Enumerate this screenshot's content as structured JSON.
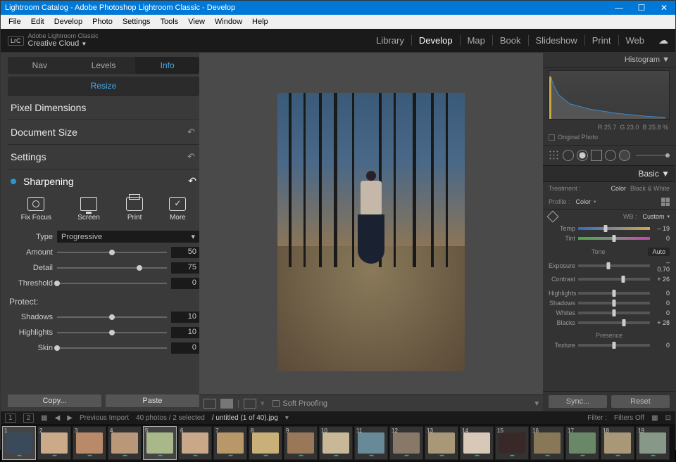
{
  "titlebar": {
    "title": "Lightroom Catalog - Adobe Photoshop Lightroom Classic - Develop"
  },
  "menubar": [
    "File",
    "Edit",
    "Develop",
    "Photo",
    "Settings",
    "Tools",
    "View",
    "Window",
    "Help"
  ],
  "brand": {
    "small": "Adobe Lightroom Classic",
    "big": "Creative Cloud",
    "badge": "LrC"
  },
  "modules": {
    "items": [
      "Library",
      "Develop",
      "Map",
      "Book",
      "Slideshow",
      "Print",
      "Web"
    ],
    "active": "Develop"
  },
  "left": {
    "tabs": [
      "Nav",
      "Levels",
      "Info"
    ],
    "active_tab": "Info",
    "resize": "Resize",
    "sections": {
      "pixel_dimensions": "Pixel Dimensions",
      "document_size": "Document Size",
      "settings": "Settings"
    },
    "sharpening": {
      "title": "Sharpening",
      "tools": {
        "fix_focus": "Fix Focus",
        "screen": "Screen",
        "print": "Print",
        "more": "More"
      },
      "type_label": "Type",
      "type_value": "Progressive",
      "amount": {
        "label": "Amount",
        "value": "50",
        "pct": 50
      },
      "detail": {
        "label": "Detail",
        "value": "75",
        "pct": 75
      },
      "threshold": {
        "label": "Threshold",
        "value": "0",
        "pct": 0
      },
      "protect": "Protect:",
      "shadows": {
        "label": "Shadows",
        "value": "10",
        "pct": 50
      },
      "highlights": {
        "label": "Highlights",
        "value": "10",
        "pct": 50
      },
      "skin": {
        "label": "Skin",
        "value": "0",
        "pct": 0
      }
    },
    "buttons": {
      "copy": "Copy...",
      "paste": "Paste"
    }
  },
  "canvas": {
    "soft_proofing": "Soft Proofing"
  },
  "right": {
    "histogram": "Histogram",
    "readout": {
      "r": "R  25.7",
      "g": "G  23.0",
      "b": "B  25.8",
      "pct": "%"
    },
    "original_photo": "Original Photo",
    "basic": "Basic",
    "treatment": {
      "label": "Treatment :",
      "color": "Color",
      "bw": "Black & White"
    },
    "profile": {
      "label": "Profile :",
      "value": "Color"
    },
    "wb": {
      "label": "WB :",
      "value": "Custom"
    },
    "temp": {
      "label": "Temp",
      "value": "– 19",
      "pct": 38
    },
    "tint": {
      "label": "Tint",
      "value": "0",
      "pct": 50
    },
    "tone": {
      "label": "Tone",
      "auto": "Auto"
    },
    "exposure": {
      "label": "Exposure",
      "value": "– 0.70",
      "pct": 42
    },
    "contrast": {
      "label": "Contrast",
      "value": "+ 26",
      "pct": 63
    },
    "highlights": {
      "label": "Highlights",
      "value": "0",
      "pct": 50
    },
    "shadows": {
      "label": "Shadows",
      "value": "0",
      "pct": 50
    },
    "whites": {
      "label": "Whites",
      "value": "0",
      "pct": 50
    },
    "blacks": {
      "label": "Blacks",
      "value": "+ 28",
      "pct": 64
    },
    "presence": {
      "label": "Presence"
    },
    "texture": {
      "label": "Texture",
      "value": "0",
      "pct": 50
    },
    "buttons": {
      "sync": "Sync...",
      "reset": "Reset"
    }
  },
  "filmstrip_hdr": {
    "nav1": "1",
    "nav2": "2",
    "previous_import": "Previous Import",
    "count": "40 photos / 2 selected",
    "filename": "/ untitled (1 of 40).jpg",
    "filter_label": "Filter :",
    "filter_value": "Filters Off"
  },
  "thumbs": [
    {
      "n": "1",
      "sel": true,
      "bg": "#3a4a5a"
    },
    {
      "n": "2",
      "sel": false,
      "bg": "#caaa88"
    },
    {
      "n": "3",
      "sel": false,
      "bg": "#b88a6a"
    },
    {
      "n": "4",
      "sel": false,
      "bg": "#b89878"
    },
    {
      "n": "5",
      "sel": true,
      "bg": "#a8b888"
    },
    {
      "n": "6",
      "sel": false,
      "bg": "#c8a888"
    },
    {
      "n": "7",
      "sel": false,
      "bg": "#b89868"
    },
    {
      "n": "8",
      "sel": false,
      "bg": "#c8b078"
    },
    {
      "n": "9",
      "sel": false,
      "bg": "#987858"
    },
    {
      "n": "10",
      "sel": false,
      "bg": "#c8b898"
    },
    {
      "n": "11",
      "sel": false,
      "bg": "#688a98"
    },
    {
      "n": "12",
      "sel": false,
      "bg": "#887868"
    },
    {
      "n": "13",
      "sel": false,
      "bg": "#a89878"
    },
    {
      "n": "14",
      "sel": false,
      "bg": "#d8c8b8"
    },
    {
      "n": "15",
      "sel": false,
      "bg": "#382828"
    },
    {
      "n": "16",
      "sel": false,
      "bg": "#887858"
    },
    {
      "n": "17",
      "sel": false,
      "bg": "#688868"
    },
    {
      "n": "18",
      "sel": false,
      "bg": "#a89878"
    },
    {
      "n": "19",
      "sel": false,
      "bg": "#889888"
    }
  ]
}
